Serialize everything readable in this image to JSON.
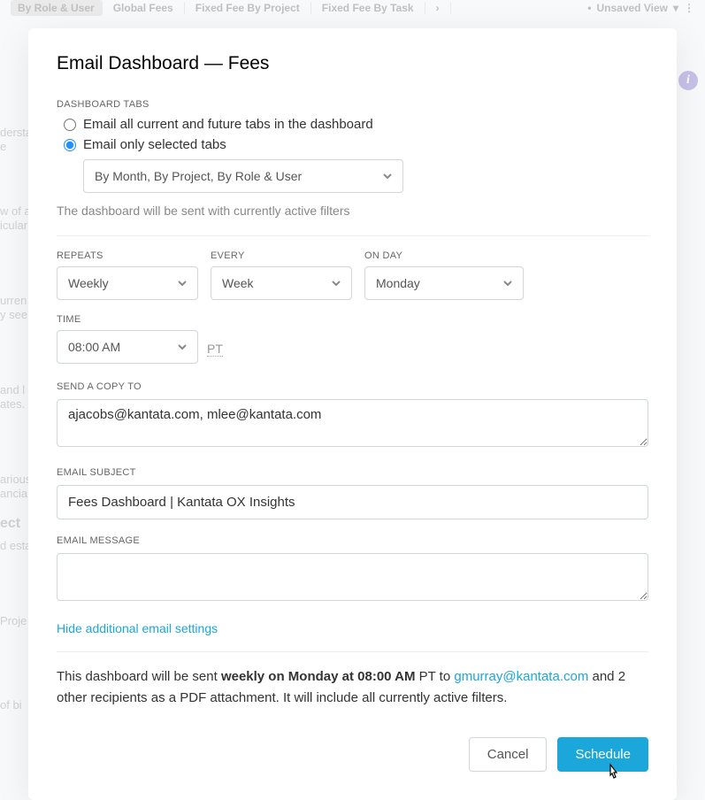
{
  "background": {
    "tabs": [
      "By Role & User",
      "Global Fees",
      "Fixed Fee By Project",
      "Fixed Fee By Task"
    ],
    "unsaved_view": "Unsaved View",
    "info_icon": "i",
    "partial_texts": {
      "t1": "dersta",
      "t2": "e",
      "t3": "w of a",
      "t4": "icular",
      "t5": "urren",
      "t6": "y see",
      "t7": "and l",
      "t8": "ates.",
      "t9": "arious",
      "t10": "ancia",
      "t11": "ect",
      "t12": "d esta",
      "t13": "Proje",
      "t14": "of bi"
    }
  },
  "modal": {
    "title": "Email Dashboard — Fees",
    "dashboard_tabs": {
      "label": "DASHBOARD TABS",
      "option_all": "Email all current and future tabs in the dashboard",
      "option_selected": "Email only selected tabs",
      "selected_tabs_value": "By Month, By Project, By Role & User",
      "filter_note": "The dashboard will be sent with currently active filters"
    },
    "repeats": {
      "label": "REPEATS",
      "value": "Weekly"
    },
    "every": {
      "label": "EVERY",
      "value": "Week"
    },
    "on_day": {
      "label": "ON DAY",
      "value": "Monday"
    },
    "time": {
      "label": "TIME",
      "value": "08:00 AM",
      "tz": "PT"
    },
    "send_to": {
      "label": "SEND A COPY TO",
      "value": "ajacobs@kantata.com, mlee@kantata.com"
    },
    "subject": {
      "label": "EMAIL SUBJECT",
      "value": "Fees Dashboard | Kantata OX Insights"
    },
    "message": {
      "label": "EMAIL MESSAGE",
      "value": ""
    },
    "hide_link": "Hide additional email settings",
    "summary": {
      "prefix": "This dashboard will be sent ",
      "bold": "weekly on Monday at 08:00 AM",
      "mid": " PT to ",
      "email": "gmurray@kantata.com",
      "suffix": " and 2 other recipients as a PDF attachment. It will include all currently active filters."
    },
    "buttons": {
      "cancel": "Cancel",
      "schedule": "Schedule"
    }
  }
}
